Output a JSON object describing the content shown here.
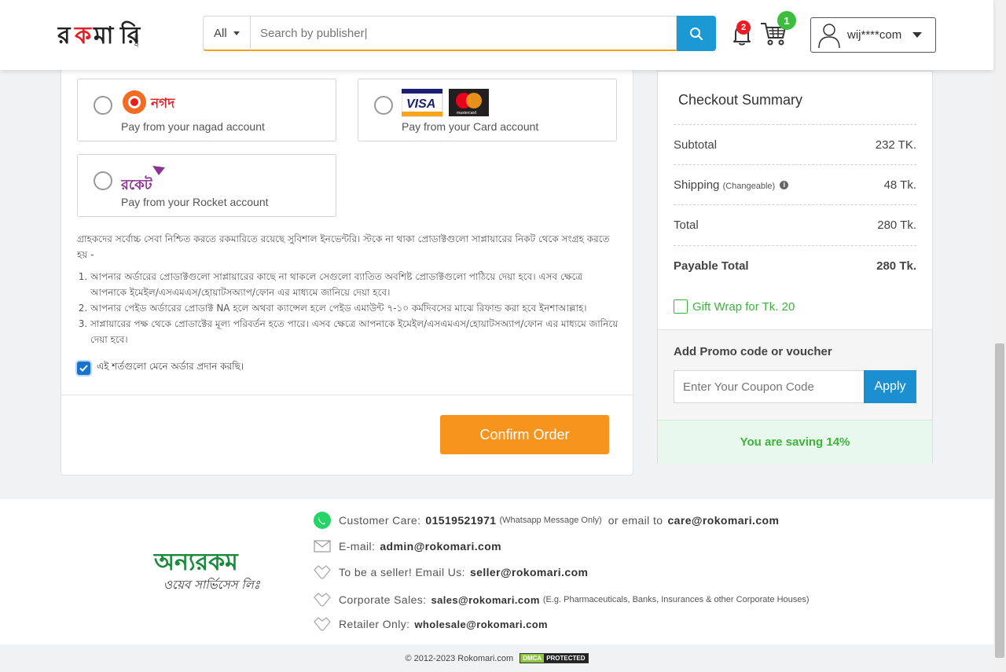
{
  "header": {
    "search_category": "All",
    "search_placeholder": "Search by publisher|",
    "notification_count": "2",
    "cart_count": "1",
    "user_name": "wij****com"
  },
  "payment": {
    "nagad_text": "Pay from your nagad account",
    "card_text": "Pay from your Card account",
    "rocket_text": "Pay from your Rocket account",
    "nagad_logo": "নগদ",
    "rocket_logo": "রকেট",
    "visa_logo": "VISA",
    "mastercard_logo": "mastercard"
  },
  "terms": {
    "intro": "গ্রাহকদের সর্বোচ্চ সেবা নিশ্চিত করতে রকমারিতে রয়েছে সুবিশাল ইনভেন্টরি। স্টকে না থাকা প্রোডাক্টগুলো সাপ্লায়ারের নিকট থেকে সংগ্রহ করতে হয় -",
    "items": [
      "আপনার অর্ডারের প্রোডাক্টগুলো সাপ্লায়ারের কাছে না থাকলে সেগুলো ব্যাতিত অবশিষ্ট প্রোডাক্টগুলো পাঠিয়ে দেয়া হবে। এসব ক্ষেত্রে আপনাকে ইমেইল/এসএমএস/হোয়াটসঅ্যাপ/ফোন এর মাধ্যমে জানিয়ে দেয়া হবে।",
      "আপনার পেইড অর্ডারের প্রোডাক্ট NA হলে অথবা ক্যান্সেল হলে পেইড এমাউন্ট ৭-১০ কর্মদিবসের মাঝে রিফান্ড করা হবে ইনশাআল্লাহ।",
      "সাপ্লায়ারের পক্ষ থেকে প্রোডাক্টের মূল্য পরিবর্তন হতে পারে। এসব ক্ষেত্রে আপনাকে ইমেইল/এসএমএস/হোয়াটসঅ্যাপ/ফোন এর মাধ্যমে জানিয়ে দেয়া হবে।"
    ],
    "agree_label": "এই শর্তগুলো মেনে অর্ডার প্রদান করছি।"
  },
  "confirm_label": "Confirm Order",
  "summary": {
    "title": "Checkout Summary",
    "subtotal_label": "Subtotal",
    "subtotal_value": "232 TK.",
    "shipping_label": "Shipping",
    "shipping_note": "(Changeable)",
    "shipping_value": "48 Tk.",
    "total_label": "Total",
    "total_value": "280 Tk.",
    "payable_label": "Payable Total",
    "payable_value": "280 Tk.",
    "gift_label": "Gift Wrap for Tk. 20",
    "promo_title": "Add Promo code or voucher",
    "promo_placeholder": "Enter Your Coupon Code",
    "apply_label": "Apply",
    "saving_text": "You are saving 14%"
  },
  "footer": {
    "brand_main": "অন্যরকম",
    "brand_sub": "ওয়েব সার্ভিসেস লিঃ",
    "care_label": "Customer Care:",
    "care_phone": "01519521971",
    "care_note": "(Whatsapp Message Only)",
    "care_or": "or email to",
    "care_email": "care@rokomari.com",
    "email_label": "E-mail:",
    "email_value": "admin@rokomari.com",
    "seller_label": "To be a seller! Email Us:",
    "seller_value": "seller@rokomari.com",
    "corp_label": "Corporate Sales:",
    "corp_value": "sales@rokomari.com",
    "corp_note": "(E.g. Pharmaceuticals, Banks, Insurances & other Corporate Houses)",
    "retail_label": "Retailer Only:",
    "retail_value": "wholesale@rokomari.com",
    "copyright": "© 2012-2023 Rokomari.com",
    "dmca_a": "DMCA",
    "dmca_b": "PROTECTED"
  },
  "colors": {
    "accent_blue": "#1b99d5",
    "confirm_orange": "#f7941d",
    "green": "#3db23d"
  }
}
